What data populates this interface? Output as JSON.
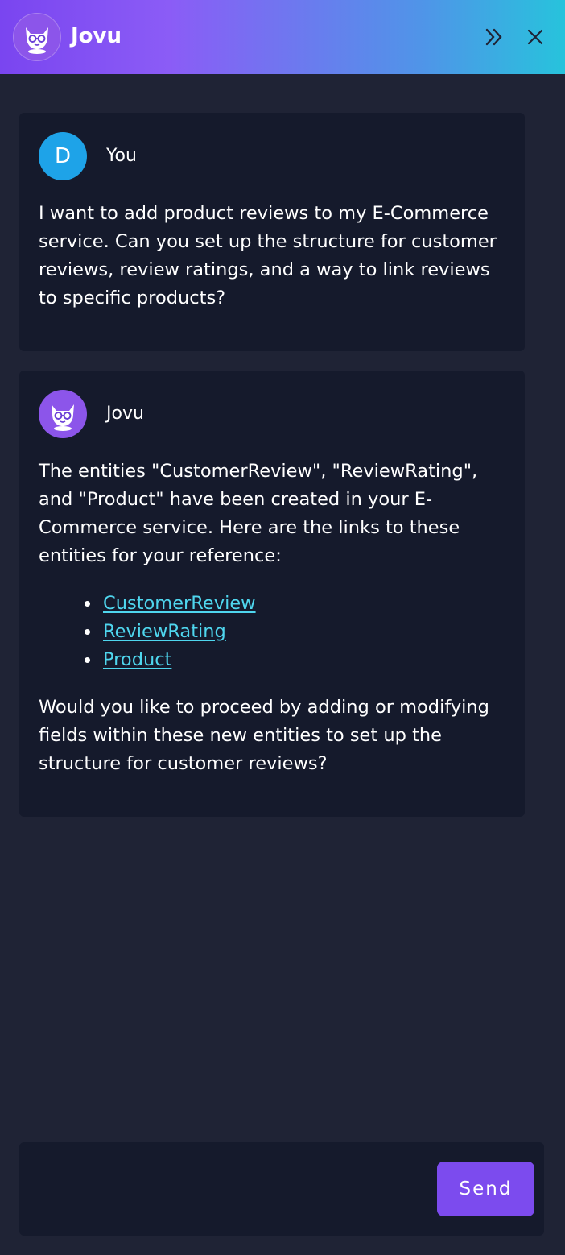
{
  "header": {
    "title": "Jovu",
    "logo_icon": "jovu-mascot-icon",
    "collapse_icon": "double-chevron-right-icon",
    "close_icon": "close-icon"
  },
  "messages": [
    {
      "sender": "You",
      "avatar_letter": "D",
      "avatar_color": "#1ea3e8",
      "text": "I want to add product reviews to my E-Commerce service. Can you set up the structure for customer reviews, review ratings, and a way to link reviews to specific products?"
    },
    {
      "sender": "Jovu",
      "avatar_icon": "jovu-mascot-icon",
      "avatar_color": "#8c55ea",
      "intro": "The entities \"CustomerReview\", \"ReviewRating\", and \"Product\" have been created in your E-Commerce service. Here are the links to these entities for your reference:",
      "links": [
        "CustomerReview",
        "ReviewRating",
        "Product"
      ],
      "outro": "Would you like to proceed by adding or modifying fields within these new entities to set up the structure for customer reviews?"
    }
  ],
  "composer": {
    "placeholder": "",
    "send_label": "Send"
  },
  "colors": {
    "background": "#1f2335",
    "card": "#151a2c",
    "accent": "#7c4bee",
    "link": "#4fd6ee"
  }
}
